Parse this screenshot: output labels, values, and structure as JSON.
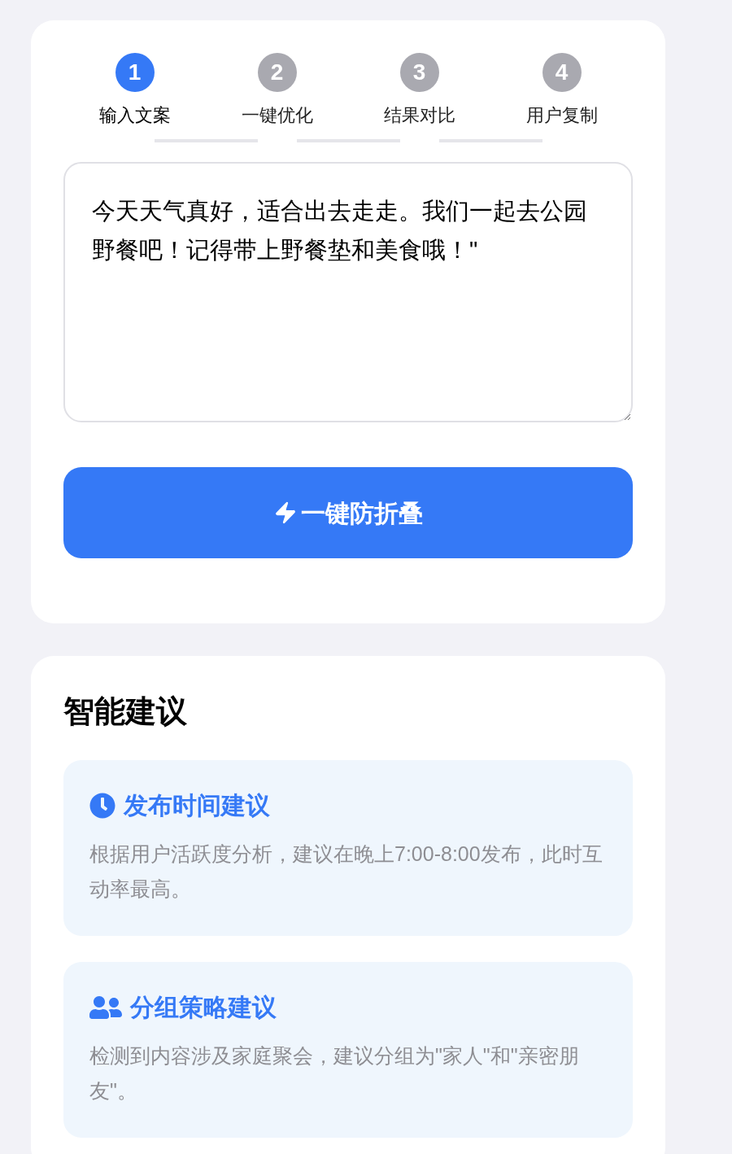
{
  "steps": [
    {
      "number": "1",
      "label": "输入文案",
      "selected": true
    },
    {
      "number": "2",
      "label": "一键优化",
      "selected": false
    },
    {
      "number": "3",
      "label": "结果对比",
      "selected": false
    },
    {
      "number": "4",
      "label": "用户复制",
      "selected": false
    }
  ],
  "editor": {
    "value": "今天天气真好，适合出去走走。我们一起去公园野餐吧！记得带上野餐垫和美食哦！\""
  },
  "action_button": {
    "label": "一键防折叠"
  },
  "suggestions": {
    "title": "智能建议",
    "items": [
      {
        "kind": "time",
        "title": "发布时间建议",
        "text": "根据用户活跃度分析，建议在晚上7:00-8:00发布，此时互动率最高。"
      },
      {
        "kind": "group",
        "title": "分组策略建议",
        "text": "检测到内容涉及家庭聚会，建议分组为\"家人\"和\"亲密朋友\"。"
      }
    ]
  }
}
